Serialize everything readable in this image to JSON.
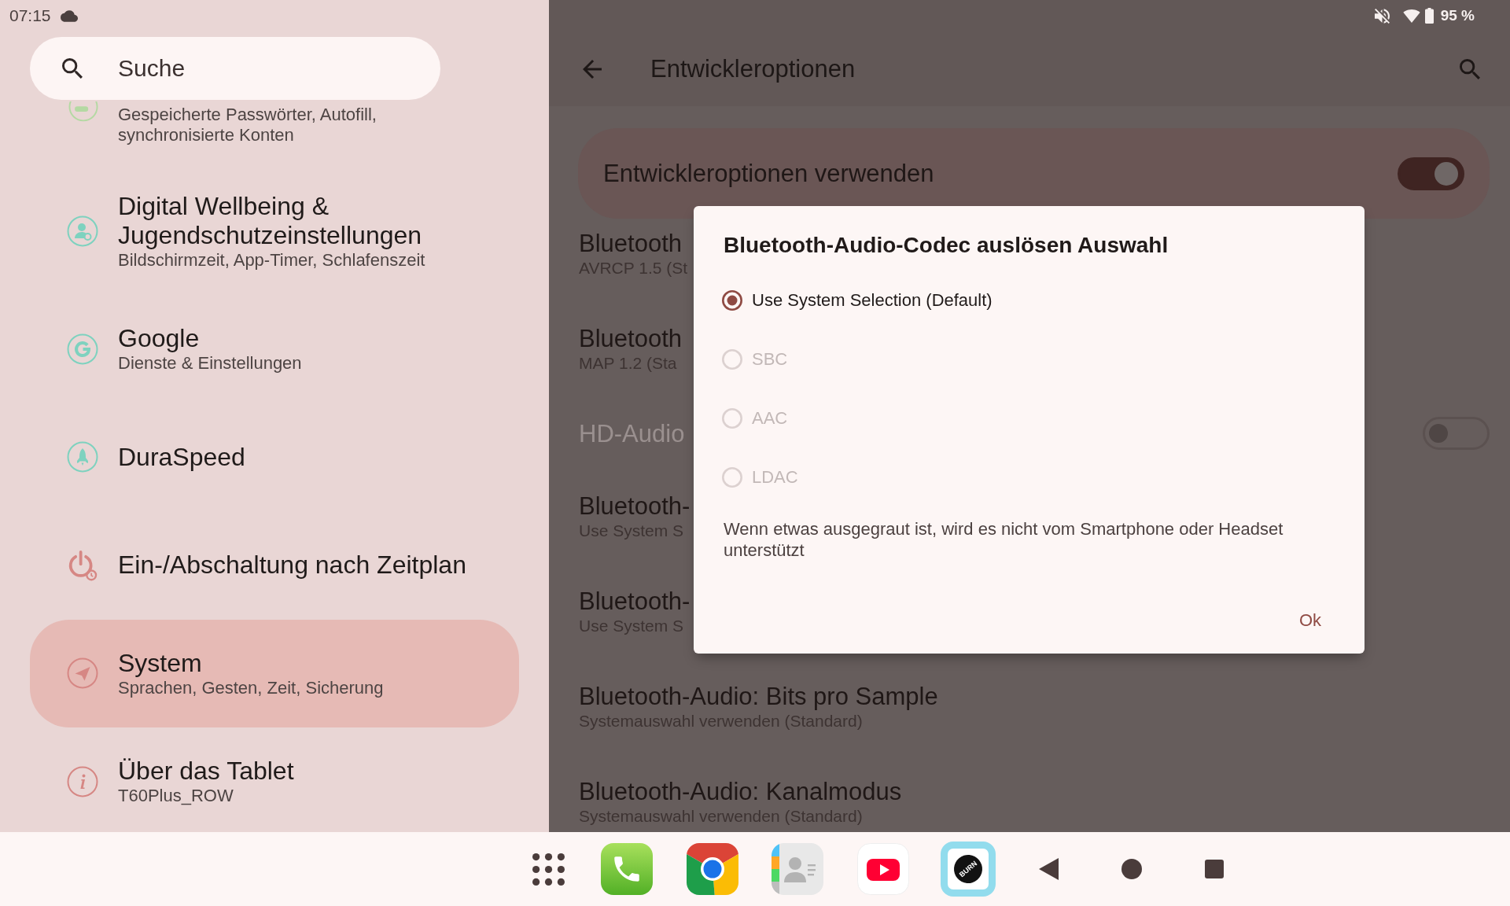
{
  "status_bar": {
    "time": "07:15",
    "battery": "95 %"
  },
  "sidebar": {
    "search": {
      "placeholder": "Suche"
    },
    "items": [
      {
        "subtitle": "Gespeicherte Passwörter, Autofill, synchronisierte Konten",
        "color": "#b4d9a3",
        "selected": false
      },
      {
        "title": "Digital Wellbeing & Jugendschutzeinstellungen",
        "subtitle": "Bildschirmzeit, App-Timer, Schlafenszeit",
        "color": "#7ed2bf",
        "selected": false
      },
      {
        "title": "Google",
        "subtitle": "Dienste & Einstellungen",
        "color": "#7ed2bf",
        "selected": false
      },
      {
        "title": "DuraSpeed",
        "color": "#7ed2bf",
        "selected": false
      },
      {
        "title": "Ein-/Abschaltung nach Zeitplan",
        "color": "#d68784",
        "selected": false
      },
      {
        "title": "System",
        "subtitle": "Sprachen, Gesten, Zeit, Sicherung",
        "color": "#d68784",
        "selected": true
      },
      {
        "title": "Über das Tablet",
        "subtitle": "T60Plus_ROW",
        "color": "#d68784",
        "selected": false
      }
    ]
  },
  "app_bar": {
    "title": "Entwickleroptionen"
  },
  "main_switch": {
    "label": "Entwickleroptionen verwenden",
    "on": true
  },
  "settings": [
    {
      "kind": "item",
      "title": "Bluetooth",
      "subtitle": "AVRCP 1.5 (St",
      "disabled": false
    },
    {
      "kind": "item",
      "title": "Bluetooth",
      "subtitle": "MAP 1.2 (Sta",
      "disabled": false
    },
    {
      "kind": "switch",
      "title": "HD-Audio",
      "on": false,
      "disabled": true
    },
    {
      "kind": "item",
      "title": "Bluetooth-",
      "subtitle": "Use System S",
      "disabled": false
    },
    {
      "kind": "item",
      "title": "Bluetooth-",
      "subtitle": "Use System S",
      "disabled": false
    },
    {
      "kind": "item",
      "title": "Bluetooth-Audio: Bits pro Sample",
      "subtitle": "Systemauswahl verwenden (Standard)",
      "disabled": false
    },
    {
      "kind": "item",
      "title": "Bluetooth-Audio: Kanalmodus",
      "subtitle": "Systemauswahl verwenden (Standard)",
      "disabled": false
    }
  ],
  "dialog": {
    "title": "Bluetooth-Audio-Codec auslösen Auswahl",
    "options": [
      {
        "label": "Use System Selection (Default)",
        "selected": true,
        "disabled": false
      },
      {
        "label": "SBC",
        "selected": false,
        "disabled": true
      },
      {
        "label": "AAC",
        "selected": false,
        "disabled": true
      },
      {
        "label": "LDAC",
        "selected": false,
        "disabled": true
      }
    ],
    "message": "Wenn etwas ausgegraut ist, wird es nicht vom Smartphone oder Headset unterstützt",
    "buttons": [
      "Ok"
    ]
  },
  "taskbar": {
    "app_logo_text": "BURN"
  }
}
